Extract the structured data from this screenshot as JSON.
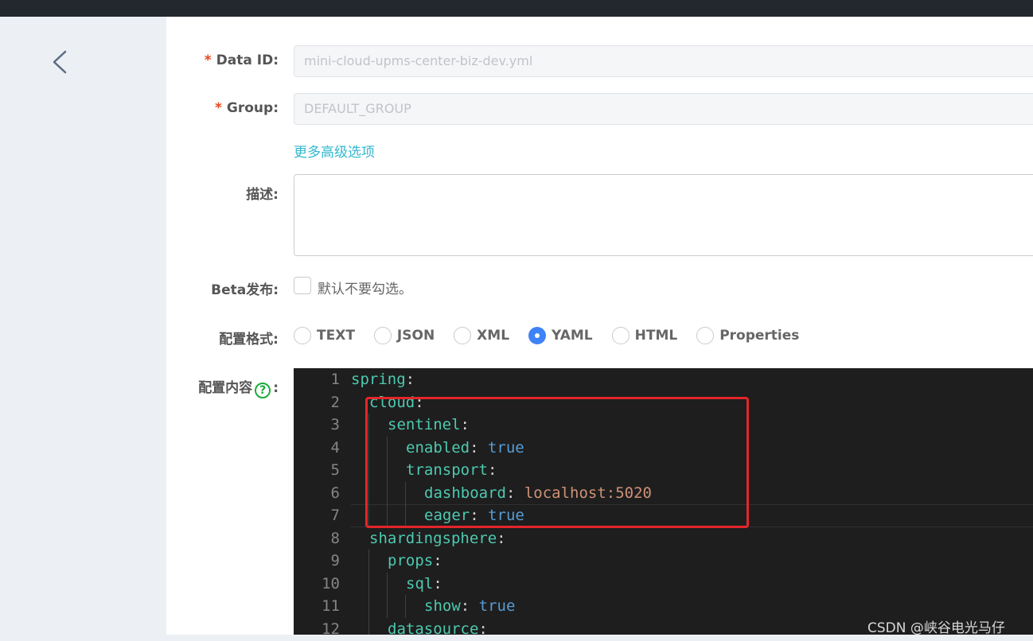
{
  "form": {
    "data_id": {
      "label": "Data ID:",
      "value": "mini-cloud-upms-center-biz-dev.yml"
    },
    "group": {
      "label": "Group:",
      "value": "DEFAULT_GROUP"
    },
    "required_mark": "*",
    "advanced_link": "更多高级选项",
    "description": {
      "label": "描述:",
      "value": ""
    },
    "beta": {
      "label": "Beta发布:",
      "checkbox_text": "默认不要勾选。",
      "checked": false
    },
    "format": {
      "label": "配置格式:",
      "options": [
        "TEXT",
        "JSON",
        "XML",
        "YAML",
        "HTML",
        "Properties"
      ],
      "selected": "YAML"
    },
    "content": {
      "label": "配置内容",
      "label_suffix": ":",
      "help_icon": "question-circle-icon",
      "help_glyph": "?"
    }
  },
  "editor": {
    "lines": [
      {
        "no": "1",
        "key": "spring",
        "sep": ":",
        "value": "",
        "vtype": ""
      },
      {
        "no": "2",
        "key": "cloud",
        "sep": ":",
        "value": "",
        "vtype": ""
      },
      {
        "no": "3",
        "key": "sentinel",
        "sep": ":",
        "value": "",
        "vtype": ""
      },
      {
        "no": "4",
        "key": "enabled",
        "sep": ": ",
        "value": "true",
        "vtype": "bool"
      },
      {
        "no": "5",
        "key": "transport",
        "sep": ":",
        "value": "",
        "vtype": ""
      },
      {
        "no": "6",
        "key": "dashboard",
        "sep": ": ",
        "value": "localhost:5020",
        "vtype": "str"
      },
      {
        "no": "7",
        "key": "eager",
        "sep": ": ",
        "value": "true",
        "vtype": "bool"
      },
      {
        "no": "8",
        "key": "shardingsphere",
        "sep": ":",
        "value": "",
        "vtype": ""
      },
      {
        "no": "9",
        "key": "props",
        "sep": ":",
        "value": "",
        "vtype": ""
      },
      {
        "no": "10",
        "key": "sql",
        "sep": ":",
        "value": "",
        "vtype": ""
      },
      {
        "no": "11",
        "key": "show",
        "sep": ": ",
        "value": "true",
        "vtype": "bool"
      },
      {
        "no": "12",
        "key": "datasource",
        "sep": ":",
        "value": "",
        "vtype": ""
      }
    ]
  },
  "watermark": "CSDN @峡谷电光马仔",
  "colors": {
    "accent": "#3e82f7",
    "link": "#33b8ce",
    "required": "#e8441d",
    "highlight_box": "#e4262a",
    "editor_bg": "#1e1e1e",
    "yaml_key": "#4ec9b0",
    "yaml_bool": "#569cd6",
    "yaml_string": "#ce9178"
  }
}
